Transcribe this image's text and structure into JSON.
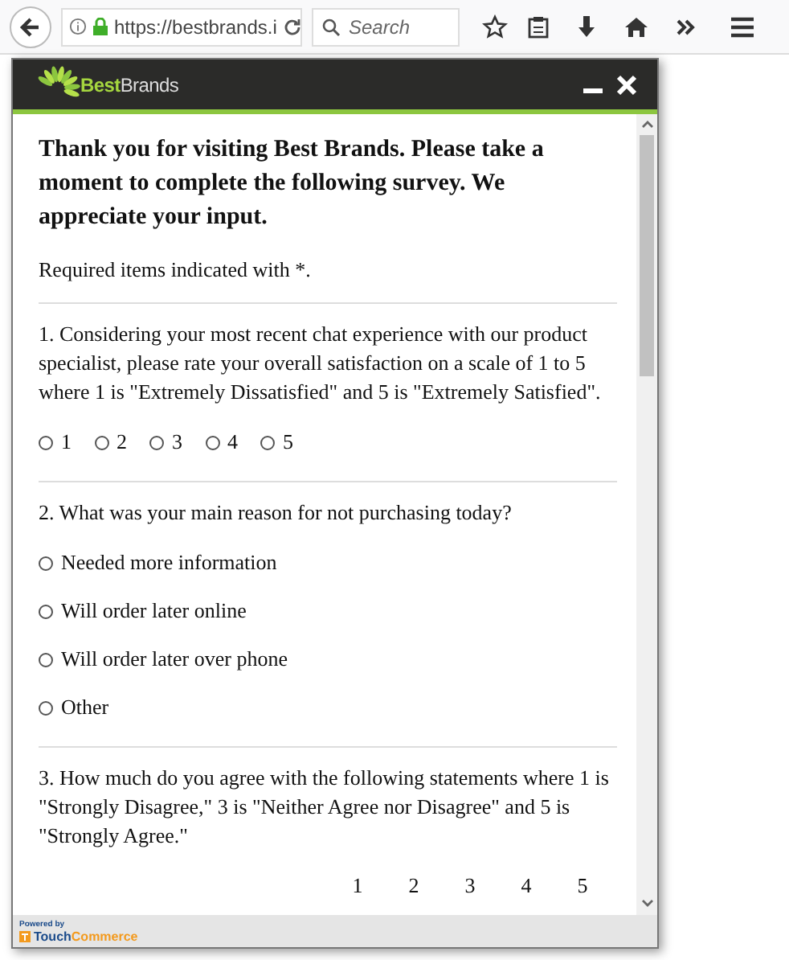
{
  "browser": {
    "url": "https://bestbrands.i",
    "search": {
      "placeholder": "Search"
    }
  },
  "popup": {
    "logo": {
      "first": "Best",
      "second": "Brands"
    },
    "intro": "Thank you for visiting Best Brands. Please take a moment to complete the following survey. We appreciate your input.",
    "required_note": "Required items indicated with *.",
    "questions": [
      {
        "kind": "inline",
        "text": "1. Considering your most recent chat experience with our product specialist, please rate your overall satisfaction on a scale of 1 to 5 where 1 is \"Extremely Dissatisfied\" and 5 is \"Extremely Satisfied\".",
        "options": [
          {
            "label": "1",
            "selected": false
          },
          {
            "label": "2",
            "selected": false
          },
          {
            "label": "3",
            "selected": false
          },
          {
            "label": "4",
            "selected": false
          },
          {
            "label": "5",
            "selected": false
          }
        ]
      },
      {
        "kind": "stacked",
        "text": "2. What was your main reason for not purchasing today?",
        "options": [
          {
            "label": "Needed more information",
            "selected": false
          },
          {
            "label": "Will order later online",
            "selected": false
          },
          {
            "label": "Will order later over phone",
            "selected": false
          },
          {
            "label": "Other",
            "selected": false
          }
        ]
      },
      {
        "kind": "scale",
        "text": "3. How much do you agree with the following statements where 1 is \"Strongly Disagree,\" 3 is \"Neither Agree nor Disagree\" and 5 is \"Strongly Agree.\"",
        "scale": [
          "1",
          "2",
          "3",
          "4",
          "5"
        ]
      }
    ],
    "footer": {
      "powered_by": "Powered by",
      "brand_first": "Touch",
      "brand_second": "Commerce"
    }
  }
}
